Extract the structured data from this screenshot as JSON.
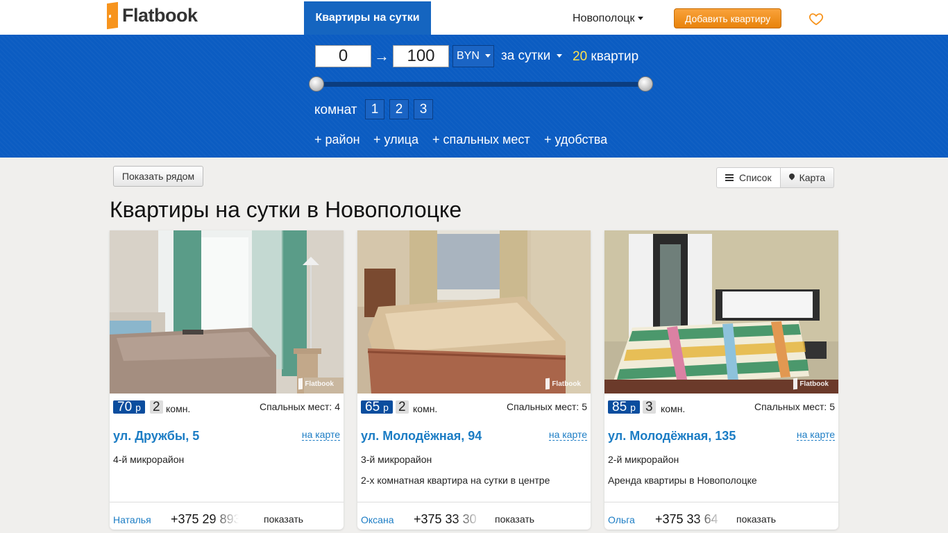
{
  "header": {
    "logo": "Flatbook",
    "nav_tab": "Квартиры на сутки",
    "city": "Новополоцк",
    "add_button": "Добавить квартиру"
  },
  "filter": {
    "price_from": "0",
    "price_to": "100",
    "arrow": "→",
    "currency": "BYN",
    "period": "за сутки",
    "result_count": "20",
    "result_unit": "квартир",
    "rooms_label": "комнат",
    "rooms_options": [
      "1",
      "2",
      "3"
    ],
    "more": [
      "+ район",
      "+ улица",
      "+ спальных мест",
      "+ удобства"
    ]
  },
  "toolbar": {
    "near_button": "Показать рядом",
    "list_button": "Список",
    "map_button": "Карта"
  },
  "page_title": "Квартиры на сутки в Новополоцке",
  "listings": [
    {
      "price": "70",
      "price_unit": "р",
      "rooms": "2",
      "rooms_unit": "комн.",
      "beds": "Спальных мест: 4",
      "address": "ул. Дружбы, 5",
      "map_link": "на карте",
      "district": "4-й микрорайон",
      "description": "",
      "owner": "Наталья",
      "phone": "+375 29 893",
      "show": "показать",
      "watermark": "Flatbook"
    },
    {
      "price": "65",
      "price_unit": "р",
      "rooms": "2",
      "rooms_unit": "комн.",
      "beds": "Спальных мест: 5",
      "address": "ул. Молодёжная, 94",
      "map_link": "на карте",
      "district": "3-й микрорайон",
      "description": "2-х комнатная квартира на сутки в центре",
      "owner": "Оксана",
      "phone": "+375 33 30",
      "show": "показать",
      "watermark": "Flatbook"
    },
    {
      "price": "85",
      "price_unit": "р",
      "rooms": "3",
      "rooms_unit": "комн.",
      "beds": "Спальных мест: 5",
      "address": "ул. Молодёжная, 135",
      "map_link": "на карте",
      "district": "2-й микрорайон",
      "description": "Аренда квартиры в Новополоцке",
      "owner": "Ольга",
      "phone": "+375 33 64",
      "show": "показать",
      "watermark": "Flatbook"
    }
  ],
  "colors": {
    "brand_orange": "#f7941d",
    "filter_blue": "#0b5cc2",
    "link_blue": "#1b7cc4",
    "price_badge": "#0a4d9e",
    "count_yellow": "#ffe44d"
  },
  "icons": [
    "flatbook-logo-icon",
    "heart-icon",
    "list-icon",
    "map-pin-icon",
    "caret-down-icon"
  ]
}
